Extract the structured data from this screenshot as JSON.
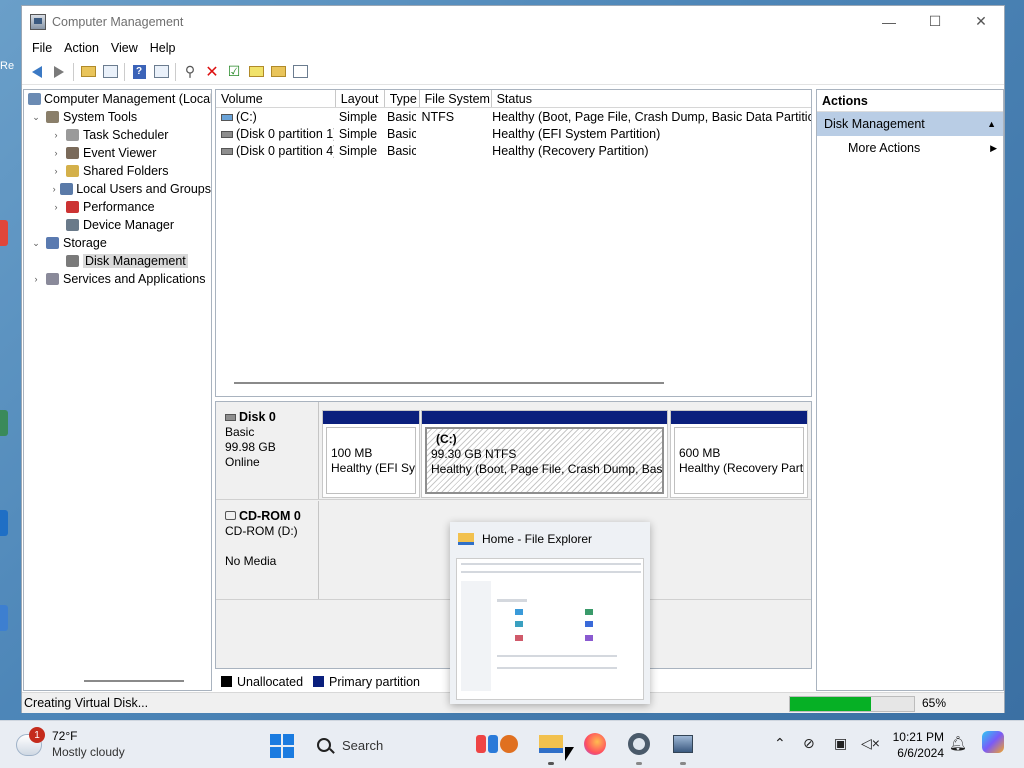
{
  "window": {
    "title": "Computer Management",
    "controls": {
      "minimize": "—",
      "maximize": "☐",
      "close": "✕"
    }
  },
  "menu": [
    "File",
    "Action",
    "View",
    "Help"
  ],
  "tree": [
    {
      "label": "Computer Management (Local",
      "level": 0,
      "exp": "",
      "icon": "computer-management-icon"
    },
    {
      "label": "System Tools",
      "level": 1,
      "exp": "⌄",
      "icon": "system-tools-icon"
    },
    {
      "label": "Task Scheduler",
      "level": 2,
      "exp": "›",
      "icon": "task-scheduler-icon"
    },
    {
      "label": "Event Viewer",
      "level": 2,
      "exp": "›",
      "icon": "event-viewer-icon"
    },
    {
      "label": "Shared Folders",
      "level": 2,
      "exp": "›",
      "icon": "shared-folders-icon"
    },
    {
      "label": "Local Users and Groups",
      "level": 2,
      "exp": "›",
      "icon": "users-icon"
    },
    {
      "label": "Performance",
      "level": 2,
      "exp": "›",
      "icon": "performance-icon"
    },
    {
      "label": "Device Manager",
      "level": 2,
      "exp": "",
      "icon": "device-manager-icon"
    },
    {
      "label": "Storage",
      "level": 1,
      "exp": "⌄",
      "icon": "storage-icon"
    },
    {
      "label": "Disk Management",
      "level": 2,
      "exp": "",
      "icon": "disk-management-icon",
      "selected": true
    },
    {
      "label": "Services and Applications",
      "level": 1,
      "exp": "›",
      "icon": "services-icon"
    }
  ],
  "volumes": {
    "columns": [
      "Volume",
      "Layout",
      "Type",
      "File System",
      "Status"
    ],
    "rows": [
      {
        "volume": "(C:)",
        "layout": "Simple",
        "type": "Basic",
        "fs": "NTFS",
        "status": "Healthy (Boot, Page File, Crash Dump, Basic Data Partition)",
        "icon": "c"
      },
      {
        "volume": "(Disk 0 partition 1)",
        "layout": "Simple",
        "type": "Basic",
        "fs": "",
        "status": "Healthy (EFI System Partition)",
        "icon": ""
      },
      {
        "volume": "(Disk 0 partition 4)",
        "layout": "Simple",
        "type": "Basic",
        "fs": "",
        "status": "Healthy (Recovery Partition)",
        "icon": ""
      }
    ]
  },
  "disk0": {
    "name": "Disk 0",
    "type": "Basic",
    "size": "99.98 GB",
    "state": "Online",
    "partitions": [
      {
        "name": "",
        "line1": "100 MB",
        "line2": "Healthy (EFI Sys"
      },
      {
        "name": "(C:)",
        "line1": "99.30 GB NTFS",
        "line2": "Healthy (Boot, Page File, Crash Dump, Basic"
      },
      {
        "name": "",
        "line1": "600 MB",
        "line2": "Healthy (Recovery Partit"
      }
    ]
  },
  "cdrom0": {
    "name": "CD-ROM 0",
    "drive": "CD-ROM (D:)",
    "state": "No Media"
  },
  "legend": {
    "unallocated": "Unallocated",
    "primary": "Primary partition"
  },
  "actions": {
    "header": "Actions",
    "section": "Disk Management",
    "more": "More Actions"
  },
  "status": {
    "text": "Creating Virtual Disk...",
    "progress": 0.65,
    "percent": "65%"
  },
  "preview": {
    "title": "Home - File Explorer"
  },
  "taskbar": {
    "weather_temp": "72°F",
    "weather_desc": "Mostly cloudy",
    "weather_badge": "1",
    "search": "Search",
    "time": "10:21 PM",
    "date": "6/6/2024"
  },
  "colors": {
    "primary_partition": "#0a1f7d",
    "progress": "#06b025",
    "selection": "#b9cde5"
  }
}
